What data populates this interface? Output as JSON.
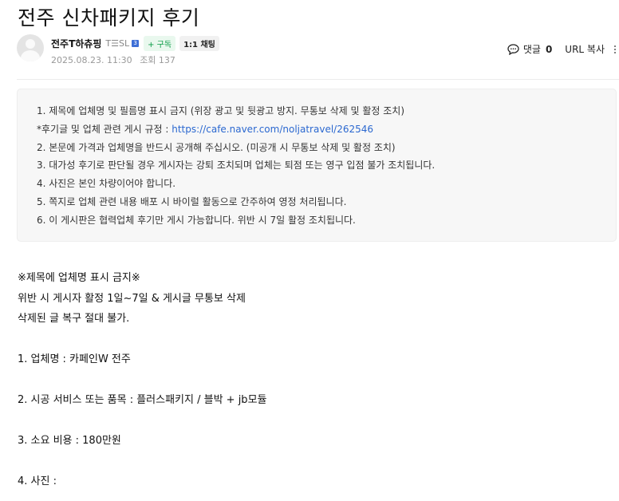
{
  "post": {
    "title": "전주 신차패키지 후기",
    "author": {
      "name": "전주T하츄핑",
      "level": "T☰SL",
      "level_badge": "3",
      "subscribe_label": "+ 구독",
      "chat_label": "1:1 채팅"
    },
    "date": "2025.08.23. 11:30",
    "views_label": "조회 137",
    "comments_label": "댓글",
    "comments_count": "0",
    "url_copy_label": "URL 복사"
  },
  "notice": {
    "line1": "1. 제목에 업체명 및 필름명 표시 금지 (위장 광고 및 뒷광고 방지. 무통보 삭제 및 활정 조치)",
    "line2_prefix": "*후기글 및 업체 관련 게시 규정 : ",
    "line2_link": "https://cafe.naver.com/noljatravel/262546",
    "line3": "2. 본문에 가격과 업체명을 반드시 공개해 주십시오. (미공개 시 무통보 삭제 및 활정 조치)",
    "line4": "3. 대가성 후기로 판단될 경우 게시자는 강퇴 조치되며 업체는 퇴점 또는 영구 입점 불가 조치됩니다.",
    "line5": "4. 사진은 본인 차량이어야 합니다.",
    "line6": "5. 쪽지로 업체 관련 내용 배포 시 바이럴 활동으로 간주하여 영정 처리됩니다.",
    "line7": "6. 이 게시판은 협력업체 후기만 게시 가능합니다. 위반 시 7일 활정 조치됩니다."
  },
  "body": {
    "warning_title": "※제목에 업체명 표시 금지※",
    "warning_line2": "위반 시 게시자 활정 1일~7일 & 게시글 무통보 삭제",
    "warning_line3": "삭제된 글 복구 절대 불가.",
    "item1": "1. 업체명 :  카페인W 전주",
    "item2": "2. 시공 서비스 또는 품목 :  플러스패키지 / 블박 + jb모듈",
    "item3": "3. 소요 비용 :  180만원",
    "item4": "4. 사진 :"
  },
  "colors": {
    "link": "#2b68d0",
    "subscribe_green": "#0a9b46",
    "level_blue": "#3e6fd6"
  }
}
